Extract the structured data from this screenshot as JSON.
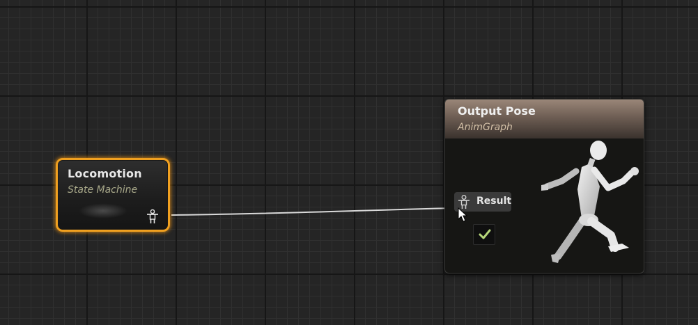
{
  "graph": {
    "state_machine_node": {
      "title": "Locomotion",
      "subtitle": "State Machine",
      "output_pin_icon": "pose-pin-icon",
      "selected": true,
      "accent_color": "#f0a020"
    },
    "output_pose_node": {
      "title": "Output Pose",
      "subtitle": "AnimGraph",
      "header_color": "#9a8678",
      "result_pin": {
        "label": "Result",
        "icon": "pose-pin-icon"
      },
      "checkbox": {
        "checked": true,
        "icon": "checkmark-icon",
        "check_color": "#b7d77a"
      },
      "illustration": "running-mannequin-icon"
    },
    "connection": {
      "from": "Locomotion",
      "to": "Result"
    },
    "cursor": "mouse-pointer-icon"
  }
}
